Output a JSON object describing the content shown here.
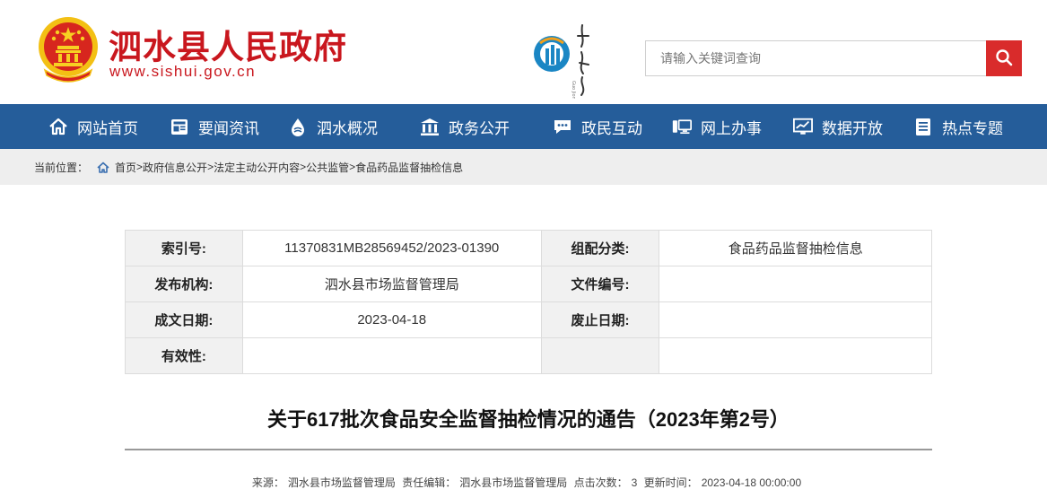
{
  "header": {
    "site_title": "泗水县人民政府",
    "site_url": "www.sishui.gov.cn",
    "emblem_icon": "national-emblem-icon",
    "partner_logo": "china-emblem-logo",
    "brand_color": "#c9171e"
  },
  "search": {
    "placeholder": "请输入关键词查询",
    "button_icon": "search-icon",
    "button_color": "#d92b2b"
  },
  "nav": {
    "background": "#255d9a",
    "items": [
      {
        "label": "网站首页",
        "icon": "home-icon"
      },
      {
        "label": "要闻资讯",
        "icon": "news-icon"
      },
      {
        "label": "泗水概况",
        "icon": "water-drop-icon"
      },
      {
        "label": "政务公开",
        "icon": "government-building-icon"
      },
      {
        "label": "政民互动",
        "icon": "chat-icon"
      },
      {
        "label": "网上办事",
        "icon": "computer-icon"
      },
      {
        "label": "数据开放",
        "icon": "chart-icon"
      },
      {
        "label": "热点专题",
        "icon": "list-icon"
      }
    ]
  },
  "breadcrumb": {
    "prefix": "当前位置：",
    "items": [
      "首页",
      "政府信息公开",
      "法定主动公开内容",
      "公共监管",
      "食品药品监督抽检信息"
    ],
    "separator": ">"
  },
  "info_table": {
    "rows": [
      {
        "label1": "索引号:",
        "value1": "11370831MB28569452/2023-01390",
        "label2": "组配分类:",
        "value2": "食品药品监督抽检信息"
      },
      {
        "label1": "发布机构:",
        "value1": "泗水县市场监督管理局",
        "label2": "文件编号:",
        "value2": ""
      },
      {
        "label1": "成文日期:",
        "value1": "2023-04-18",
        "label2": "废止日期:",
        "value2": ""
      },
      {
        "label1": "有效性:",
        "value1": "",
        "label2": "",
        "value2": ""
      }
    ]
  },
  "article": {
    "title": "关于617批次食品安全监督抽检情况的通告（2023年第2号）",
    "source_label": "来源：",
    "source": "泗水县市场监督管理局",
    "editor_label": "责任编辑：",
    "editor": "泗水县市场监督管理局",
    "clicks_label": "点击次数：",
    "clicks": "3",
    "updated_label": "更新时间：",
    "updated": "2023-04-18 00:00:00"
  }
}
